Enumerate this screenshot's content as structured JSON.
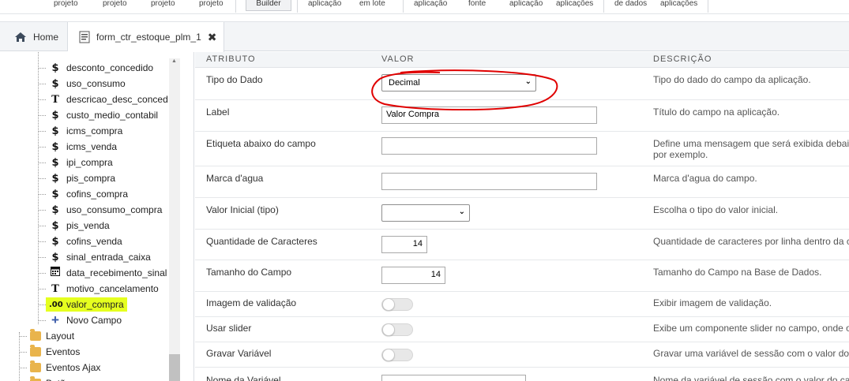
{
  "toolbar": {
    "items": [
      "projeto",
      "projeto",
      "projeto",
      "projeto",
      "Builder",
      "aplicação",
      "em lote",
      "aplicação",
      "fonte",
      "aplicação",
      "aplicações",
      "de dados",
      "aplicações"
    ]
  },
  "tabs": {
    "home_label": "Home",
    "form_label": "form_ctr_estoque_plm_1",
    "close_glyph": "✖"
  },
  "tree": {
    "fields": [
      {
        "glyph": "$",
        "label": "desconto_concedido"
      },
      {
        "glyph": "$",
        "label": "uso_consumo"
      },
      {
        "glyph": "T",
        "label": "descricao_desc_conced"
      },
      {
        "glyph": "$",
        "label": "custo_medio_contabil"
      },
      {
        "glyph": "$",
        "label": "icms_compra"
      },
      {
        "glyph": "$",
        "label": "icms_venda"
      },
      {
        "glyph": "$",
        "label": "ipi_compra"
      },
      {
        "glyph": "$",
        "label": "pis_compra"
      },
      {
        "glyph": "$",
        "label": "cofins_compra"
      },
      {
        "glyph": "$",
        "label": "uso_consumo_compra"
      },
      {
        "glyph": "$",
        "label": "pis_venda"
      },
      {
        "glyph": "$",
        "label": "cofins_venda"
      },
      {
        "glyph": "$",
        "label": "sinal_entrada_caixa"
      },
      {
        "glyph": "cal",
        "label": "data_recebimento_sinal"
      },
      {
        "glyph": "T",
        "label": "motivo_cancelamento"
      }
    ],
    "selected": {
      "glyph": ".00",
      "label": "valor_compra"
    },
    "new_field": "Novo Campo",
    "folders": [
      "Layout",
      "Eventos",
      "Eventos Ajax",
      "Botões"
    ]
  },
  "grid": {
    "headers": {
      "attr": "ATRIBUTO",
      "value": "VALOR",
      "desc": "DESCRIÇÃO"
    },
    "rows": {
      "tipo": {
        "attr": "Tipo do Dado",
        "value": "Decimal",
        "desc": "Tipo do dado do campo da aplicação."
      },
      "label": {
        "attr": "Label",
        "value": "Valor Compra",
        "desc": "Título do campo na aplicação."
      },
      "etiqueta": {
        "attr": "Etiqueta abaixo do campo",
        "value": "",
        "desc": "Define uma mensagem que será exibida debai",
        "desc2": "por exemplo."
      },
      "marca": {
        "attr": "Marca d'agua",
        "value": "",
        "desc": "Marca d'agua do campo."
      },
      "valor_inicial": {
        "attr": "Valor Inicial (tipo)",
        "value": "",
        "desc": "Escolha o tipo do valor inicial."
      },
      "qtd": {
        "attr": "Quantidade de Caracteres",
        "value": "14",
        "desc": "Quantidade de caracteres por linha dentro da c"
      },
      "tamanho": {
        "attr": "Tamanho do Campo",
        "value": "14",
        "desc": "Tamanho do Campo na Base de Dados."
      },
      "imagem": {
        "attr": "Imagem de validação",
        "value": "off",
        "desc": "Exibir imagem de validação."
      },
      "slider": {
        "attr": "Usar slider",
        "value": "off",
        "desc": "Exibe um componente slider no campo, onde o"
      },
      "gravar": {
        "attr": "Gravar Variável",
        "value": "off",
        "desc": "Gravar uma variável de sessão com o valor do"
      },
      "nome_var": {
        "attr": "Nome da Variável",
        "value": "",
        "desc": "Nome da variável de sessão com o valor do ca"
      }
    }
  },
  "colors": {
    "highlight": "#e5ff1f",
    "annotation": "#e00000",
    "tree_plus": "#3b5ba9"
  }
}
